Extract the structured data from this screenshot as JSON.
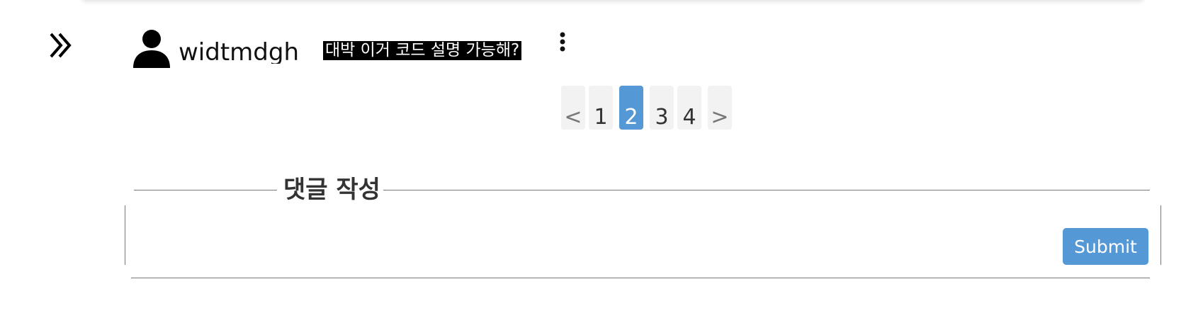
{
  "comment": {
    "username": "widtmdgh",
    "text": "대박 이거 코드 설명 가능해?"
  },
  "icons": {
    "collapse": "double-chevron-right-icon",
    "avatar": "user-icon",
    "menu": "kebab-menu-icon"
  },
  "pagination": {
    "prev_label": "<",
    "next_label": ">",
    "pages": [
      "1",
      "2",
      "3",
      "4"
    ],
    "current": "2"
  },
  "comment_form": {
    "legend": "댓글 작성",
    "input_value": "",
    "submit_label": "Submit"
  },
  "colors": {
    "accent": "#5598d6",
    "page_button_bg": "#f2f2f2",
    "highlight_bg": "#000000"
  }
}
